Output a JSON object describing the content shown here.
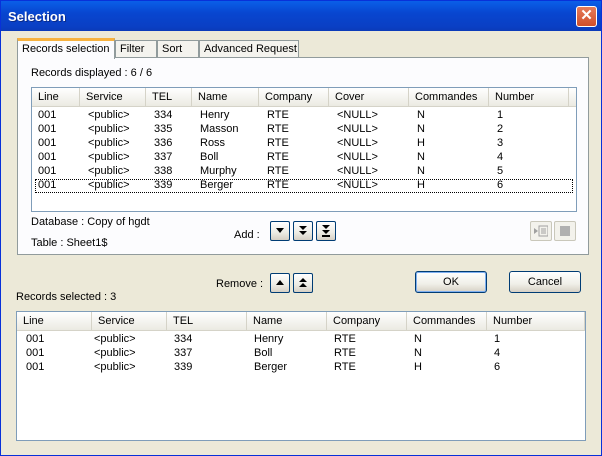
{
  "window": {
    "title": "Selection"
  },
  "tabs": [
    {
      "label": "Records selection"
    },
    {
      "label": "Filter"
    },
    {
      "label": "Sort"
    },
    {
      "label": "Advanced Request"
    }
  ],
  "records_displayed_label": "Records displayed : 6 / 6",
  "columns": [
    "Line",
    "Service",
    "TEL",
    "Name",
    "Company",
    "Cover",
    "Commandes",
    "Number"
  ],
  "records": [
    [
      "001",
      "<public>",
      "334",
      "Henry",
      "RTE",
      "<NULL>",
      "N",
      "1"
    ],
    [
      "001",
      "<public>",
      "335",
      "Masson",
      "RTE",
      "<NULL>",
      "N",
      "2"
    ],
    [
      "001",
      "<public>",
      "336",
      "Ross",
      "RTE",
      "<NULL>",
      "H",
      "3"
    ],
    [
      "001",
      "<public>",
      "337",
      "Boll",
      "RTE",
      "<NULL>",
      "N",
      "4"
    ],
    [
      "001",
      "<public>",
      "338",
      "Murphy",
      "RTE",
      "<NULL>",
      "N",
      "5"
    ],
    [
      "001",
      "<public>",
      "339",
      "Berger",
      "RTE",
      "<NULL>",
      "H",
      "6"
    ]
  ],
  "database_label": "Database : Copy of hgdt",
  "table_label": "Table : Sheet1$",
  "add_label": "Add :",
  "remove_label": "Remove :",
  "ok_label": "OK",
  "cancel_label": "Cancel",
  "records_selected_label": "Records selected :  3",
  "selected_columns": [
    "Line",
    "Service",
    "TEL",
    "Name",
    "Company",
    "Commandes",
    "Number"
  ],
  "selected_records": [
    [
      "001",
      "<public>",
      "334",
      "Henry",
      "RTE",
      "N",
      "1"
    ],
    [
      "001",
      "<public>",
      "337",
      "Boll",
      "RTE",
      "N",
      "4"
    ],
    [
      "001",
      "<public>",
      "339",
      "Berger",
      "RTE",
      "H",
      "6"
    ]
  ]
}
